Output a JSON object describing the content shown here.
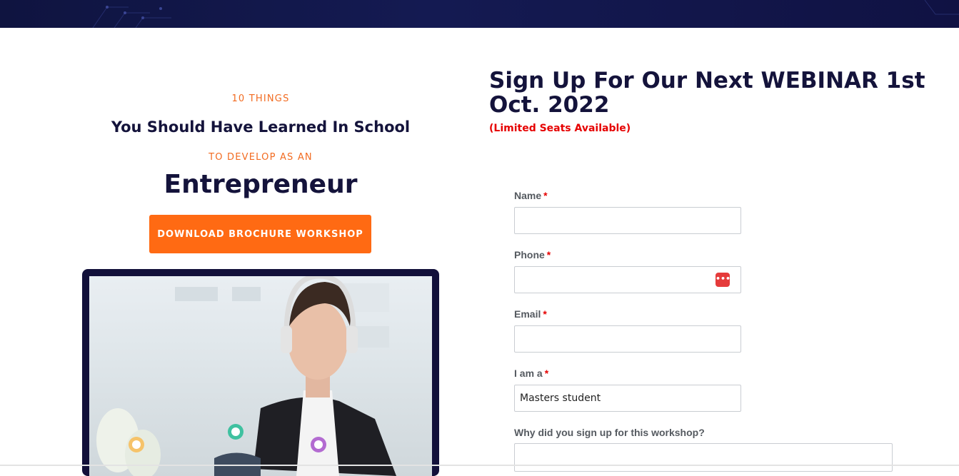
{
  "left": {
    "eyebrow_top": "10 THINGS",
    "subheading": "You Should Have Learned In School",
    "eyebrow_mid": "TO DEVELOP AS AN",
    "big_word": "Entrepreneur",
    "cta_label": "DOWNLOAD BROCHURE WORKSHOP"
  },
  "signup": {
    "heading": "Sign Up For Our Next WEBINAR 1st Oct. 2022",
    "notice": "(Limited Seats Available)"
  },
  "form": {
    "required_mark": "*",
    "name_label": "Name",
    "phone_label": "Phone",
    "email_label": "Email",
    "role_label": "I am a",
    "role_value": "Masters student",
    "reason_label": "Why did you sign up for this workshop?",
    "phone_icon_glyph": "•••"
  },
  "icons": {
    "phone_helper": "password-manager-icon"
  },
  "colors": {
    "banner": "#141a52",
    "accent": "#ff6a13",
    "heading": "#14133b",
    "required": "#e60000"
  }
}
